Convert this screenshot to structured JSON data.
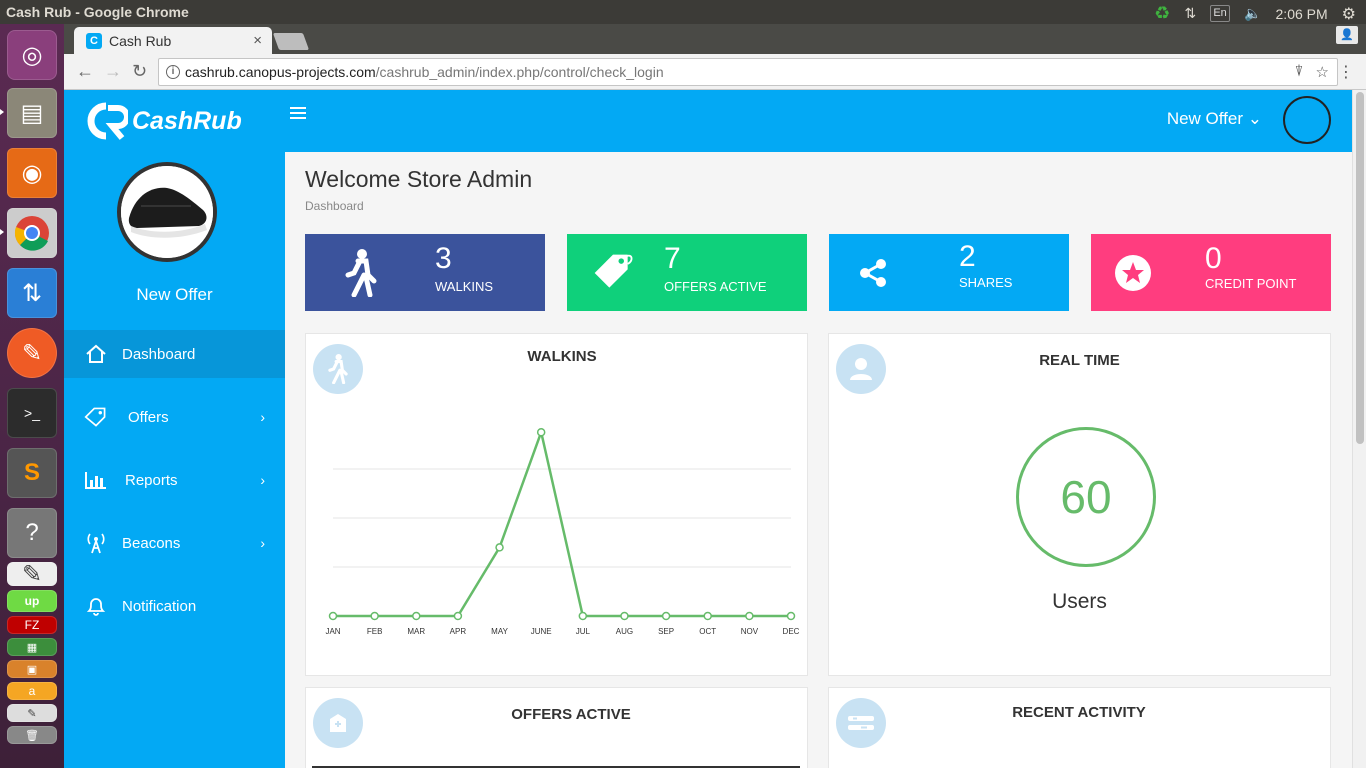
{
  "os": {
    "window_title": "Cash Rub - Google Chrome",
    "lang": "En",
    "time": "2:06 PM"
  },
  "browser": {
    "tab_title": "Cash Rub",
    "tab_close": "×",
    "url_host": "cashrub.canopus-projects.com",
    "url_path": "/cashrub_admin/index.php/control/check_login"
  },
  "sidebar": {
    "brand": "CashRub",
    "name": "New Offer",
    "items": [
      {
        "label": "Dashboard",
        "icon": "home-icon",
        "chevron": ""
      },
      {
        "label": "Offers",
        "icon": "tag-icon",
        "chevron": "›"
      },
      {
        "label": "Reports",
        "icon": "bar-chart-icon",
        "chevron": "›"
      },
      {
        "label": "Beacons",
        "icon": "antenna-icon",
        "chevron": "›"
      },
      {
        "label": "Notification",
        "icon": "bell-icon",
        "chevron": ""
      }
    ]
  },
  "appbar": {
    "new_offer": "New Offer ⌄"
  },
  "header": {
    "title": "Welcome Store Admin",
    "breadcrumb": "Dashboard"
  },
  "stats": [
    {
      "value": "3",
      "label": "WALKINS",
      "color": "#3b539c"
    },
    {
      "value": "7",
      "label": "OFFERS ACTIVE",
      "color": "#0fd07b"
    },
    {
      "value": "2",
      "label": "SHARES",
      "color": "#03a9f4"
    },
    {
      "value": "0",
      "label": "CREDIT POINT",
      "color": "#ff3d7f"
    }
  ],
  "cards": {
    "walkins_title": "WALKINS",
    "realtime_title": "REAL TIME",
    "realtime_value": "60",
    "realtime_label": "Users",
    "offers_active_title": "OFFERS ACTIVE",
    "recent_activity_title": "RECENT ACTIVITY"
  },
  "chart_data": {
    "type": "line",
    "categories": [
      "JAN",
      "FEB",
      "MAR",
      "APR",
      "MAY",
      "JUNE",
      "JUL",
      "AUG",
      "SEP",
      "OCT",
      "NOV",
      "DEC"
    ],
    "values": [
      0,
      0,
      0,
      0,
      1.4,
      3.75,
      0,
      0,
      0,
      0,
      0,
      0
    ],
    "title": "WALKINS",
    "ylim": [
      0,
      4
    ],
    "grid": true,
    "color": "#66bb6a"
  }
}
